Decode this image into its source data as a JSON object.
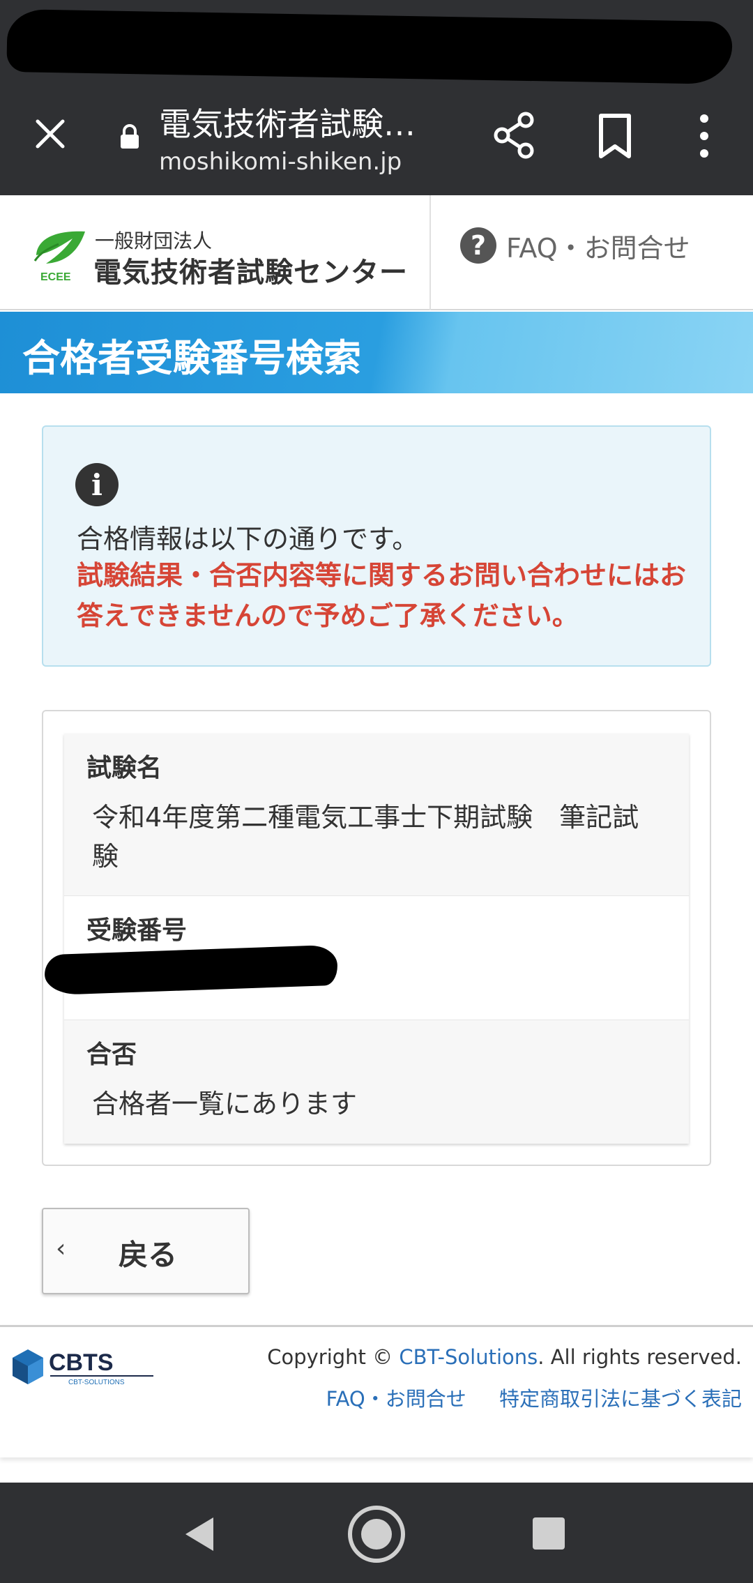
{
  "browser": {
    "page_title": "電気技術者試験…",
    "domain": "moshikomi-shiken.jp"
  },
  "header": {
    "org_type": "一般財団法人",
    "org_name": "電気技術者試験センター",
    "logo_sub": "ECEE",
    "faq_label": "FAQ・お問合せ"
  },
  "banner": {
    "title": "合格者受験番号検索"
  },
  "info": {
    "line1": "合格情報は以下の通りです。",
    "warning": "試験結果・合否内容等に関するお問い合わせにはお答えできませんので予めご了承ください。"
  },
  "result": {
    "rows": [
      {
        "label": "試験名",
        "value": "令和4年度第二種電気工事士下期試験　筆記試験"
      },
      {
        "label": "受験番号",
        "value": ""
      },
      {
        "label": "合否",
        "value": "合格者一覧にあります"
      }
    ]
  },
  "back_button": {
    "chevron": "‹",
    "label": "戻る"
  },
  "footer": {
    "logo_text": "CBTS",
    "logo_sub": "CBT-SOLUTIONS",
    "copyright_prefix": "Copyright © ",
    "copyright_link": "CBT-Solutions",
    "copyright_suffix": ". All rights reserved.",
    "links": [
      "FAQ・お問合せ",
      "特定商取引法に基づく表記"
    ]
  },
  "colors": {
    "warning_red": "#d64536",
    "banner_blue": "#1e8fd6",
    "link_blue": "#2a6fb8",
    "chrome_dark": "#2f3033"
  }
}
